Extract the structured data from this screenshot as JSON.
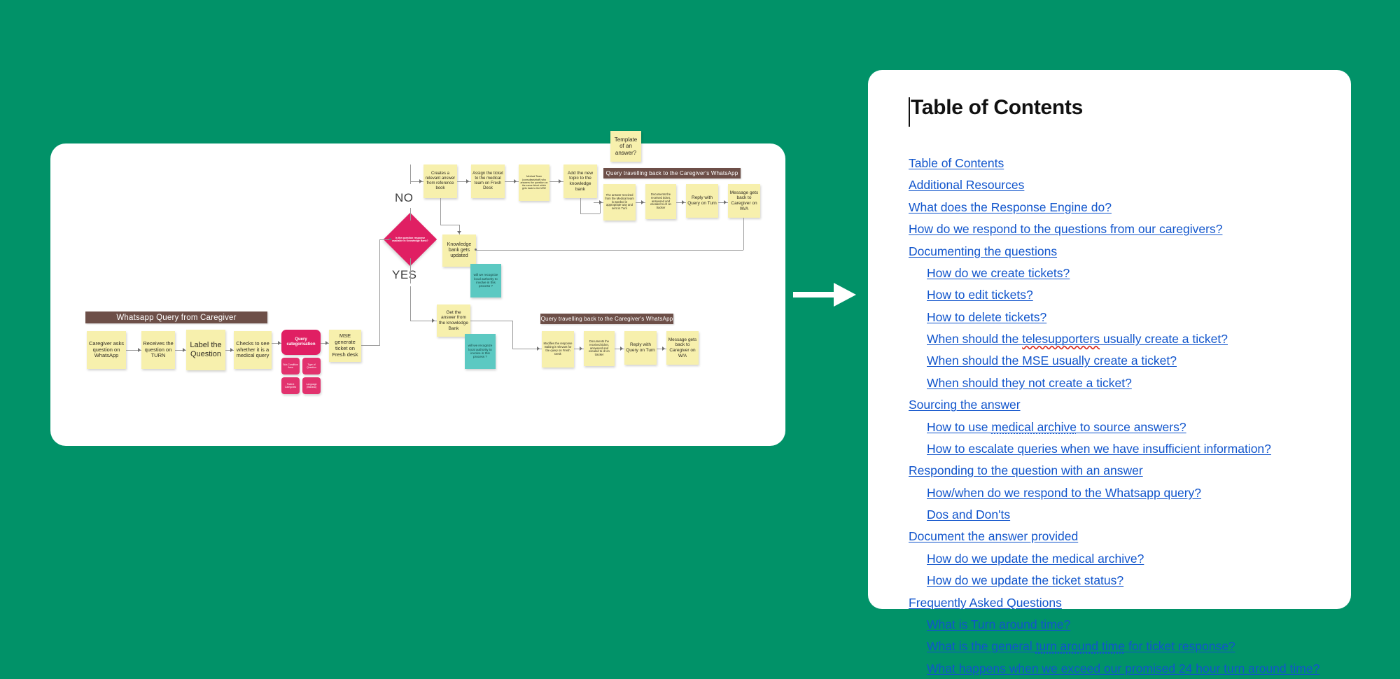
{
  "page": {
    "background_color": "#019268",
    "transition_icon": "right-arrow-icon"
  },
  "diagram": {
    "title_bars": [
      {
        "label": "Whatsapp Query from Caregiver"
      },
      {
        "label": "Query travelling back to the Caregiver's WhatsApp"
      },
      {
        "label": "Query travelling back to the Caregiver's WhatsApp"
      }
    ],
    "intake_nodes": [
      {
        "label": "Caregiver asks question on WhatsApp"
      },
      {
        "label": "Receives the question on TURN"
      },
      {
        "label": "Label the Question"
      },
      {
        "label": "Checks to see whether it is a medical query"
      }
    ],
    "categorisation": {
      "label": "Query categorisation",
      "sub_items": [
        {
          "label": "Sub-Condition Area"
        },
        {
          "label": "Type of Question"
        },
        {
          "label": "Patient Categories"
        },
        {
          "label": "Language (Bahasa)"
        }
      ]
    },
    "mse_node": {
      "label": "MSE generate ticket on Fresh desk"
    },
    "decision": {
      "label": "Is the question response available in Knowledge Bank?",
      "no_label": "NO",
      "yes_label": "YES"
    },
    "no_branch": [
      {
        "label": "Creates a relevant answer from reference book"
      },
      {
        "label": "Assign the ticket to the medical team on Fresh Desk"
      },
      {
        "label": "Medical Team (consultant/staff) who answers the question on the same ticket which gets back to the MSE"
      },
      {
        "label": "Add the new topic to the knowledge bank"
      }
    ],
    "template_note": {
      "label": "Template of an answer?"
    },
    "knowledge_bank_updated": {
      "label": "Knowledge bank gets updated"
    },
    "teal_note": {
      "label": "will we recognize local authority to involve in this process ?"
    },
    "top_return_flow": [
      {
        "label": "The answer received from the Medical team is worded in appropriate way and sent in Turn"
      },
      {
        "label": "Documents the received ticket, answered and escaled to dr on tracker"
      },
      {
        "label": "Reply with Query on Turn"
      },
      {
        "label": "Message gets back to Caregiver on W/A"
      }
    ],
    "yes_branch": [
      {
        "label": "Get the answer from the knowledge Bank"
      }
    ],
    "bottom_return_flow": [
      {
        "label": "Modifies the response making it relevant for the query on Fresh Desk"
      },
      {
        "label": "Documents the received ticket, answered and escaled to dr on tracker"
      },
      {
        "label": "Reply with Query on Turn"
      },
      {
        "label": "Message gets back to Caregiver on W/A"
      }
    ],
    "colors": {
      "note_yellow": "#f7f0ad",
      "note_teal": "#5cc9c2",
      "pink": "#e01f63",
      "bar_brown": "#6d4f48"
    }
  },
  "document": {
    "title": "Table of Contents",
    "link_color": "#1155cc",
    "toc": [
      {
        "label": "Table of Contents",
        "level": 1
      },
      {
        "label": "Additional Resources",
        "level": 1
      },
      {
        "label": "What does the Response Engine do?",
        "level": 1
      },
      {
        "label": "How do we respond to the questions from our caregivers?",
        "level": 1
      },
      {
        "label": "Documenting the questions",
        "level": 1
      },
      {
        "label": "How do we create tickets?",
        "level": 2
      },
      {
        "label": "How to edit tickets?",
        "level": 2
      },
      {
        "label": "How to delete tickets?",
        "level": 2
      },
      {
        "label": "When should the telesupporters usually create a ticket?",
        "level": 2,
        "spellcheck_word": "telesupporters"
      },
      {
        "label": "When should the MSE usually create a ticket?",
        "level": 2
      },
      {
        "label": "When should they not create a ticket?",
        "level": 2
      },
      {
        "label": "Sourcing the answer",
        "level": 1
      },
      {
        "label": "How to use medical archive to source answers?",
        "level": 2,
        "grammar_phrase": "medical archive"
      },
      {
        "label": "How to escalate queries when we have insufficient information?",
        "level": 2
      },
      {
        "label": "Responding to the question with an answer",
        "level": 1
      },
      {
        "label": "How/when do we respond to the Whatsapp query?",
        "level": 2
      },
      {
        "label": "Dos and Don'ts",
        "level": 2
      },
      {
        "label": "Document the answer provided",
        "level": 1
      },
      {
        "label": "How do we update the medical archive?",
        "level": 2
      },
      {
        "label": "How do we update the ticket status?",
        "level": 2
      },
      {
        "label": "Frequently Asked Questions",
        "level": 1
      },
      {
        "label": "What is Turn around time?",
        "level": 2
      },
      {
        "label": "What is the general turn around time for ticket response?",
        "level": 2,
        "grammar_phrase": "turn around time"
      },
      {
        "label": "What happens when we exceed our promised 24 hour turn around time?",
        "level": 2
      }
    ]
  }
}
